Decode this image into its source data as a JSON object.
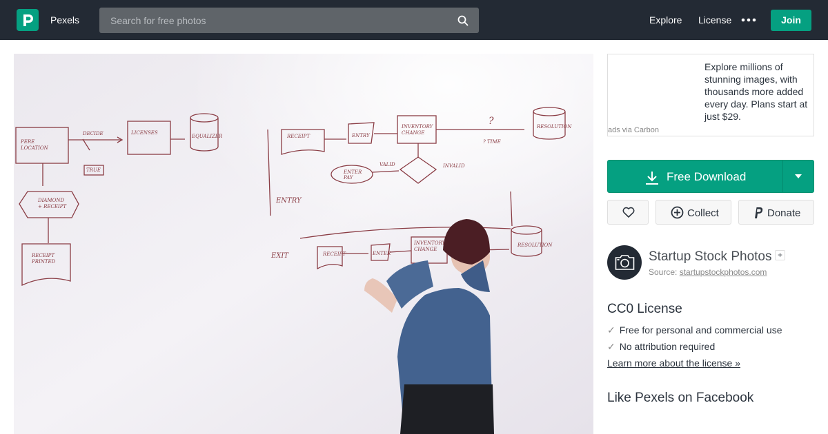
{
  "header": {
    "brand": "Pexels",
    "search_placeholder": "Search for free photos",
    "nav": {
      "explore": "Explore",
      "license": "License"
    },
    "join_label": "Join"
  },
  "ad": {
    "text": "Explore millions of stunning images, with thousands more added every day. Plans start at just $29.",
    "via": "ads via Carbon"
  },
  "download": {
    "label": "Free Download"
  },
  "actions": {
    "collect": "Collect",
    "donate": "Donate"
  },
  "author": {
    "name": "Startup Stock Photos",
    "follow": "+",
    "source_label": "Source:",
    "source_link": "startupstockphotos.com"
  },
  "license": {
    "title": "CC0 License",
    "items": [
      "Free for personal and commercial use",
      "No attribution required"
    ],
    "link": "Learn more about the license »"
  },
  "facebook": {
    "title": "Like Pexels on Facebook"
  },
  "colors": {
    "accent": "#05a081",
    "header_bg": "#232a34",
    "text": "#2c343e"
  }
}
